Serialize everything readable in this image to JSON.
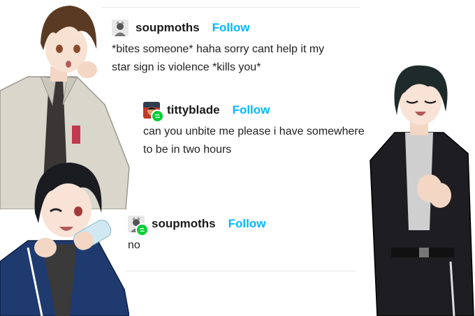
{
  "posts": [
    {
      "username": "soupmoths",
      "follow_label": "Follow",
      "avatar_icon": "avatar-soupmoths",
      "reblog": false,
      "text_lines": [
        "*bites someone* haha sorry cant help it my",
        "star sign is violence *kills you*"
      ]
    },
    {
      "username": "tittyblade",
      "follow_label": "Follow",
      "avatar_icon": "avatar-tittyblade",
      "reblog": true,
      "text_lines": [
        "can you unbite me please i have somewhere",
        "to be in two hours"
      ]
    },
    {
      "username": "soupmoths",
      "follow_label": "Follow",
      "avatar_icon": "avatar-soupmoths",
      "reblog": true,
      "text_lines": [
        "no"
      ]
    }
  ],
  "colors": {
    "follow": "#00b8ff",
    "reblog_badge": "#00cf35",
    "text": "#222222"
  }
}
